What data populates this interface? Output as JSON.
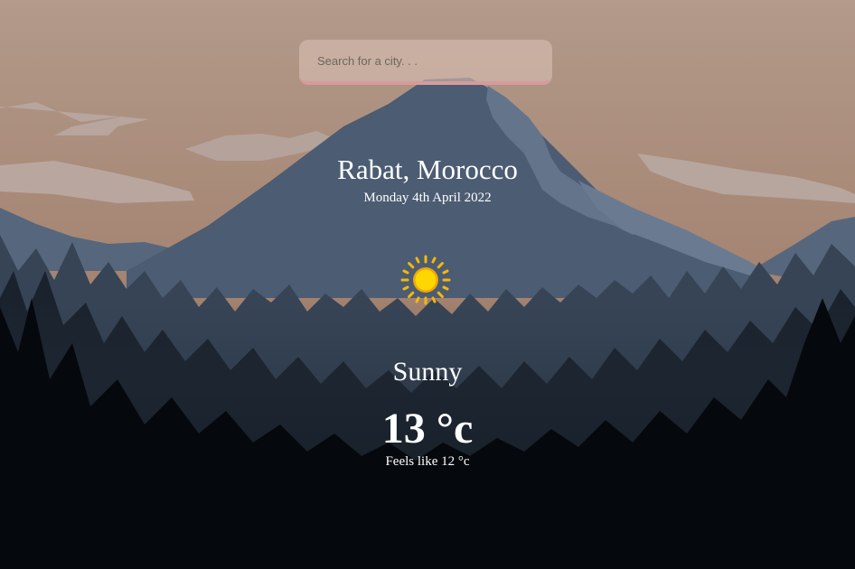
{
  "search": {
    "placeholder": "Search for a city. . ."
  },
  "weather": {
    "location": "Rabat, Morocco",
    "date": "Monday 4th April 2022",
    "icon": "sun-icon",
    "condition": "Sunny",
    "temperature": "13 °c",
    "feels_like": "Feels like 12 °c"
  },
  "colors": {
    "sky_top": "#b29888",
    "sky_bottom": "#9d7a65",
    "mountain": "#4a5a70",
    "forest_dark": "#06090d",
    "search_underline": "#d69b9b",
    "sun": "#f6c20b"
  }
}
